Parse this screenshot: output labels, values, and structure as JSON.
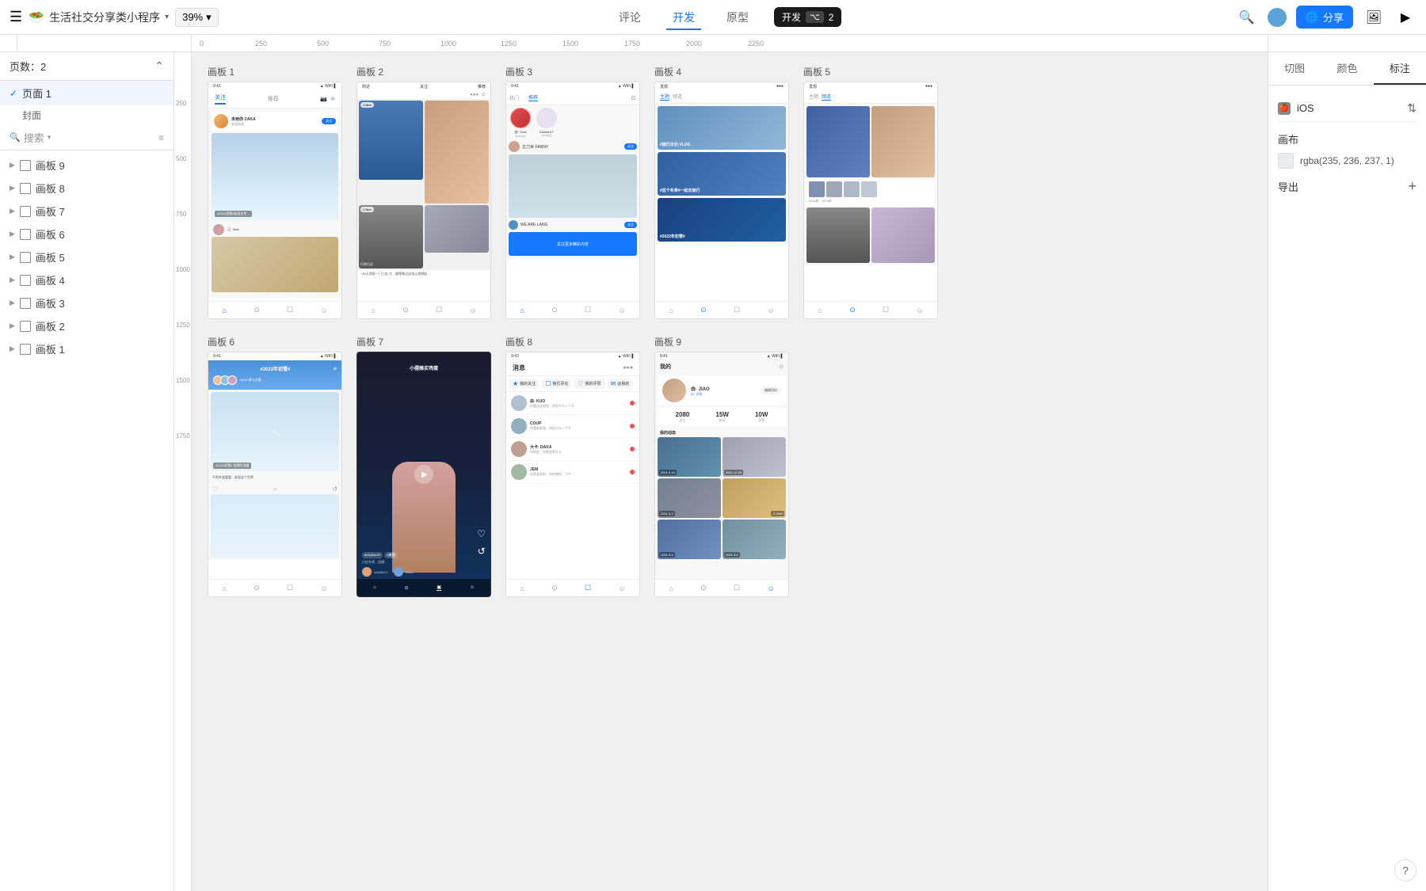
{
  "topbar": {
    "hamburger": "☰",
    "app_emoji": "🥗",
    "app_name": "生活社交分享类小程序",
    "dropdown_arrow": "▾",
    "zoom": "39%",
    "nav_tabs": [
      "评论",
      "开发",
      "原型"
    ],
    "active_tab": "开发",
    "dev_badge": "开发",
    "dev_key": "⌥",
    "dev_num": "2",
    "share_label": "分享",
    "icons": [
      "search",
      "circle",
      "globe",
      "image",
      "play"
    ]
  },
  "ruler": {
    "marks": [
      "0",
      "250",
      "500",
      "750",
      "1000",
      "1250",
      "1500",
      "1750",
      "2000",
      "2250"
    ],
    "v_marks": [
      "250",
      "500",
      "750",
      "1000",
      "1250",
      "1500",
      "1750"
    ]
  },
  "sidebar": {
    "page_count_label": "页数：2",
    "pages": [
      {
        "name": "页面 1",
        "active": true,
        "check": "✓"
      }
    ],
    "cover_label": "封面",
    "search_placeholder": "搜索",
    "frames": [
      "画板 9",
      "画板 8",
      "画板 7",
      "画板 6",
      "画板 5",
      "画板 4",
      "画板 3",
      "画板 2",
      "画板 1"
    ]
  },
  "right_panel": {
    "tabs": [
      "切图",
      "颜色",
      "标注"
    ],
    "active_tab": "标注",
    "platform": "iOS",
    "platform_icon": "",
    "section_canvas": "画布",
    "color_value": "rgba(235, 236, 237, 1)",
    "export_label": "导出"
  },
  "boards": {
    "row1": [
      {
        "label": "画板 1",
        "type": "follow"
      },
      {
        "label": "画板 2",
        "type": "explore"
      },
      {
        "label": "画板 3",
        "type": "feed"
      },
      {
        "label": "画板 4",
        "type": "discover"
      },
      {
        "label": "画板 5",
        "type": "publish"
      }
    ],
    "row2": [
      {
        "label": "画板 6",
        "type": "topic"
      },
      {
        "label": "画板 7",
        "type": "video"
      },
      {
        "label": "画板 8",
        "type": "messages"
      },
      {
        "label": "画板 9",
        "type": "profile"
      }
    ]
  },
  "help": "?"
}
